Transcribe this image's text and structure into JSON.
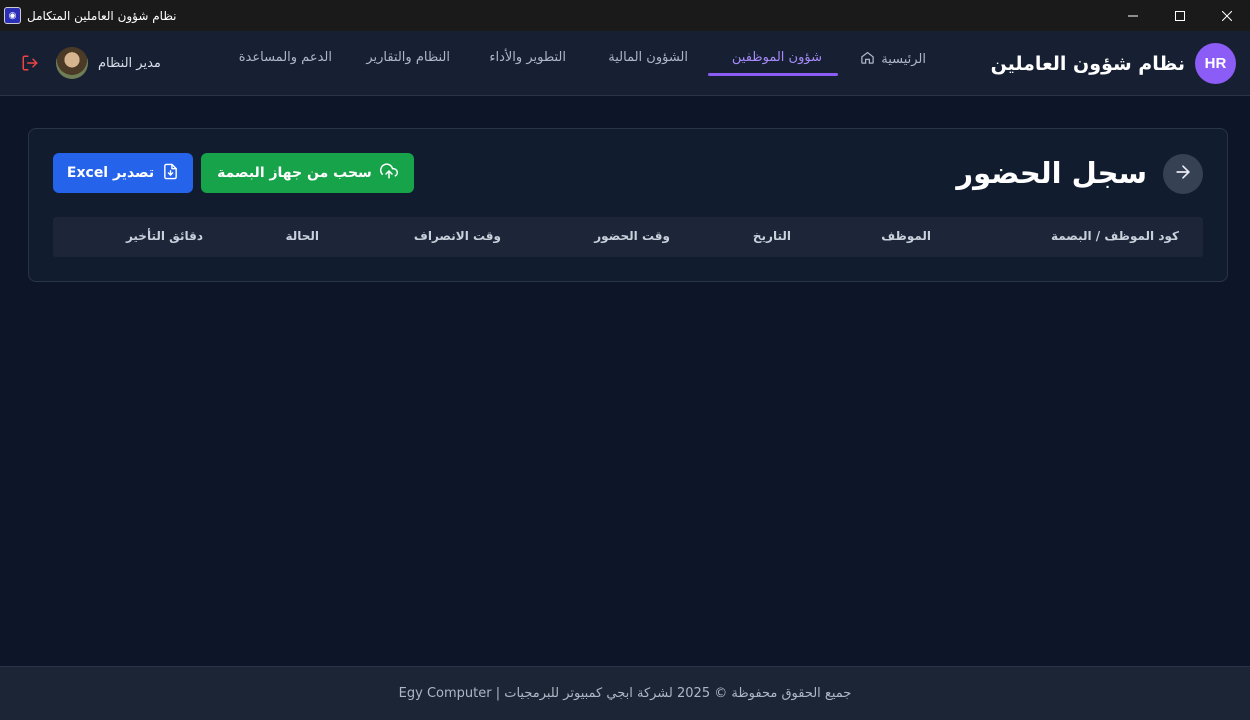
{
  "window": {
    "title": "نظام شؤون العاملين المتكامل",
    "controls": [
      "minimize-icon",
      "maximize-icon",
      "close-icon"
    ]
  },
  "navbar": {
    "brand_badge": "HR",
    "brand_title": "نظام شؤون العاملين",
    "items": [
      {
        "label": "الرئيسية",
        "icon": "home-icon"
      },
      {
        "label": "شؤون الموظفين",
        "active": true
      },
      {
        "label": "الشؤون المالية"
      },
      {
        "label": "التطوير والأداء"
      },
      {
        "label": "النظام والتقارير"
      },
      {
        "label": "الدعم والمساعدة"
      }
    ],
    "user_name": "مدير النظام",
    "logout_icon": "logout-icon"
  },
  "page": {
    "title": "سجل الحضور",
    "back_icon": "arrow-right-icon",
    "sync_button": "سحب من جهاز البصمة",
    "export_button": "تصدير Excel",
    "table_headers": [
      "كود الموظف / البصمة",
      "الموظف",
      "التاريخ",
      "وقت الحضور",
      "وقت الانصراف",
      "الحالة",
      "دقائق التأخير"
    ],
    "rows": []
  },
  "footer": {
    "text": "جميع الحقوق محفوظة © 2025 لشركة ابجي كمبيوتر للبرمجيات | Egy Computer"
  },
  "colors": {
    "accent": "#8b5cf6",
    "green": "#16a34a",
    "blue": "#2563eb",
    "background": "#0d1628"
  }
}
